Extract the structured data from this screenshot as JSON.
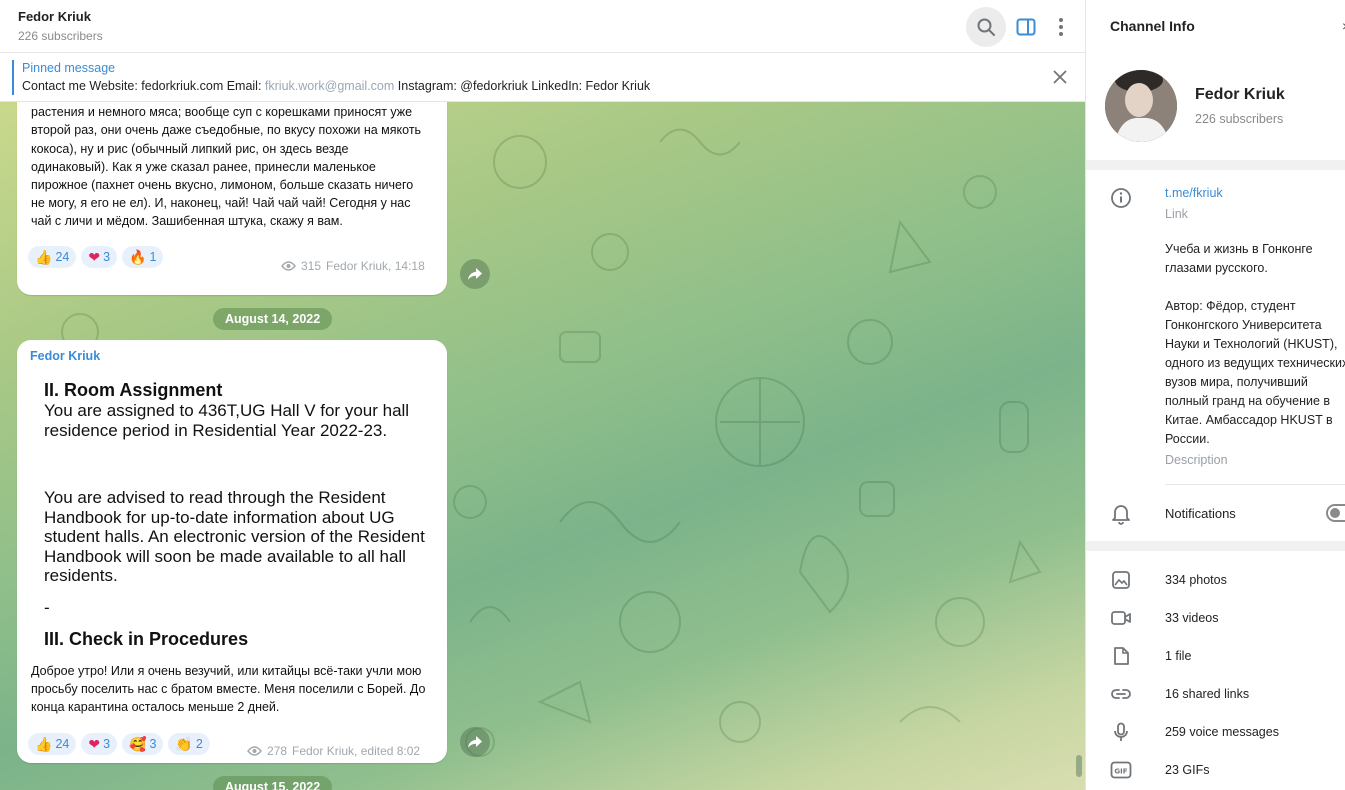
{
  "header": {
    "title": "Fedor Kriuk",
    "subtitle": "226 subscribers",
    "icons": [
      "search-icon",
      "sidebar-toggle-icon",
      "more-vertical-icon"
    ]
  },
  "pinned": {
    "title": "Pinned message",
    "text_a": "Contact me Website: fedorkriuk.com Email: ",
    "text_mail": "fkriuk.work@gmail.com",
    "text_b": " Instagram: @fedorkriuk LinkedIn: Fedor Kriuk"
  },
  "messages": [
    {
      "text": "листьев, суп (горячая вода, в которой плавают корни какого-то растения и немного мяса; вообще суп с корешками приносят уже второй раз, они очень даже съедобные, по вкусу похожи на мякоть кокоса), ну и рис (обычный липкий рис, он здесь везде одинаковый). Как я уже сказал ранее, принесли маленькое пирожное (пахнет очень вкусно, лимоном, больше сказать ничего не могу, я его не ел). И, наконец, чай! Чай чай чай! Сегодня у нас чай с личи и мёдом. Зашибенная штука, скажу я вам.",
      "reactions": [
        {
          "emoji": "👍",
          "count": "24"
        },
        {
          "emoji": "❤",
          "count": "3"
        },
        {
          "emoji": "🔥",
          "count": "1"
        }
      ],
      "views": "315",
      "signature": "Fedor Kriuk, 14:18"
    },
    {
      "sender": "Fedor Kriuk",
      "doc": {
        "heading1": "II.  Room Assignment",
        "para1": "You are assigned to 436T,UG Hall V for your hall residence period in Residential Year 2022-23.",
        "para2": "You are advised to read through the Resident Handbook for up-to-date information about UG student halls. An electronic version of the Resident Handbook will soon be made available to all hall residents.",
        "dash": "-",
        "heading2": "III. Check in Procedures"
      },
      "caption": "Доброе утро! Или я очень везучий, или китайцы всё-таки учли мою просьбу поселить нас с братом вместе. Меня поселили с Борей. До конца карантина осталось меньше 2 дней.",
      "reactions": [
        {
          "emoji": "👍",
          "count": "24"
        },
        {
          "emoji": "❤",
          "count": "3"
        },
        {
          "emoji": "🥰",
          "count": "3"
        },
        {
          "emoji": "👏",
          "count": "2"
        }
      ],
      "views": "278",
      "signature": "Fedor Kriuk, edited 8:02"
    }
  ],
  "dates": [
    "August 14, 2022",
    "August 15, 2022"
  ],
  "info": {
    "title": "Channel Info",
    "close": "×",
    "name": "Fedor Kriuk",
    "subscribers": "226 subscribers",
    "link": "t.me/fkriuk",
    "link_label": "Link",
    "description_1": "Учеба и жизнь в Гонконге глазами русского.",
    "description_2": "Автор: Фёдор, студент Гонконгского Университета Науки и Технологий (HKUST), одного из ведущих технических вузов мира, получивший полный гранд на обучение в Китае. Амбассадор HKUST в России.",
    "description_label": "Description",
    "notifications": "Notifications",
    "media": [
      {
        "icon": "photo-icon",
        "label": "334 photos"
      },
      {
        "icon": "video-icon",
        "label": "33 videos"
      },
      {
        "icon": "file-icon",
        "label": "1 file"
      },
      {
        "icon": "link-icon",
        "label": "16 shared links"
      },
      {
        "icon": "microphone-icon",
        "label": "259 voice messages"
      },
      {
        "icon": "gif-icon",
        "label": "23 GIFs"
      }
    ]
  },
  "colors": {
    "accent": "#3a8bd8",
    "wallpaper_start": "#c9d98c",
    "wallpaper_mid": "#7cb38a",
    "wallpaper_end": "#d9ddb0"
  }
}
